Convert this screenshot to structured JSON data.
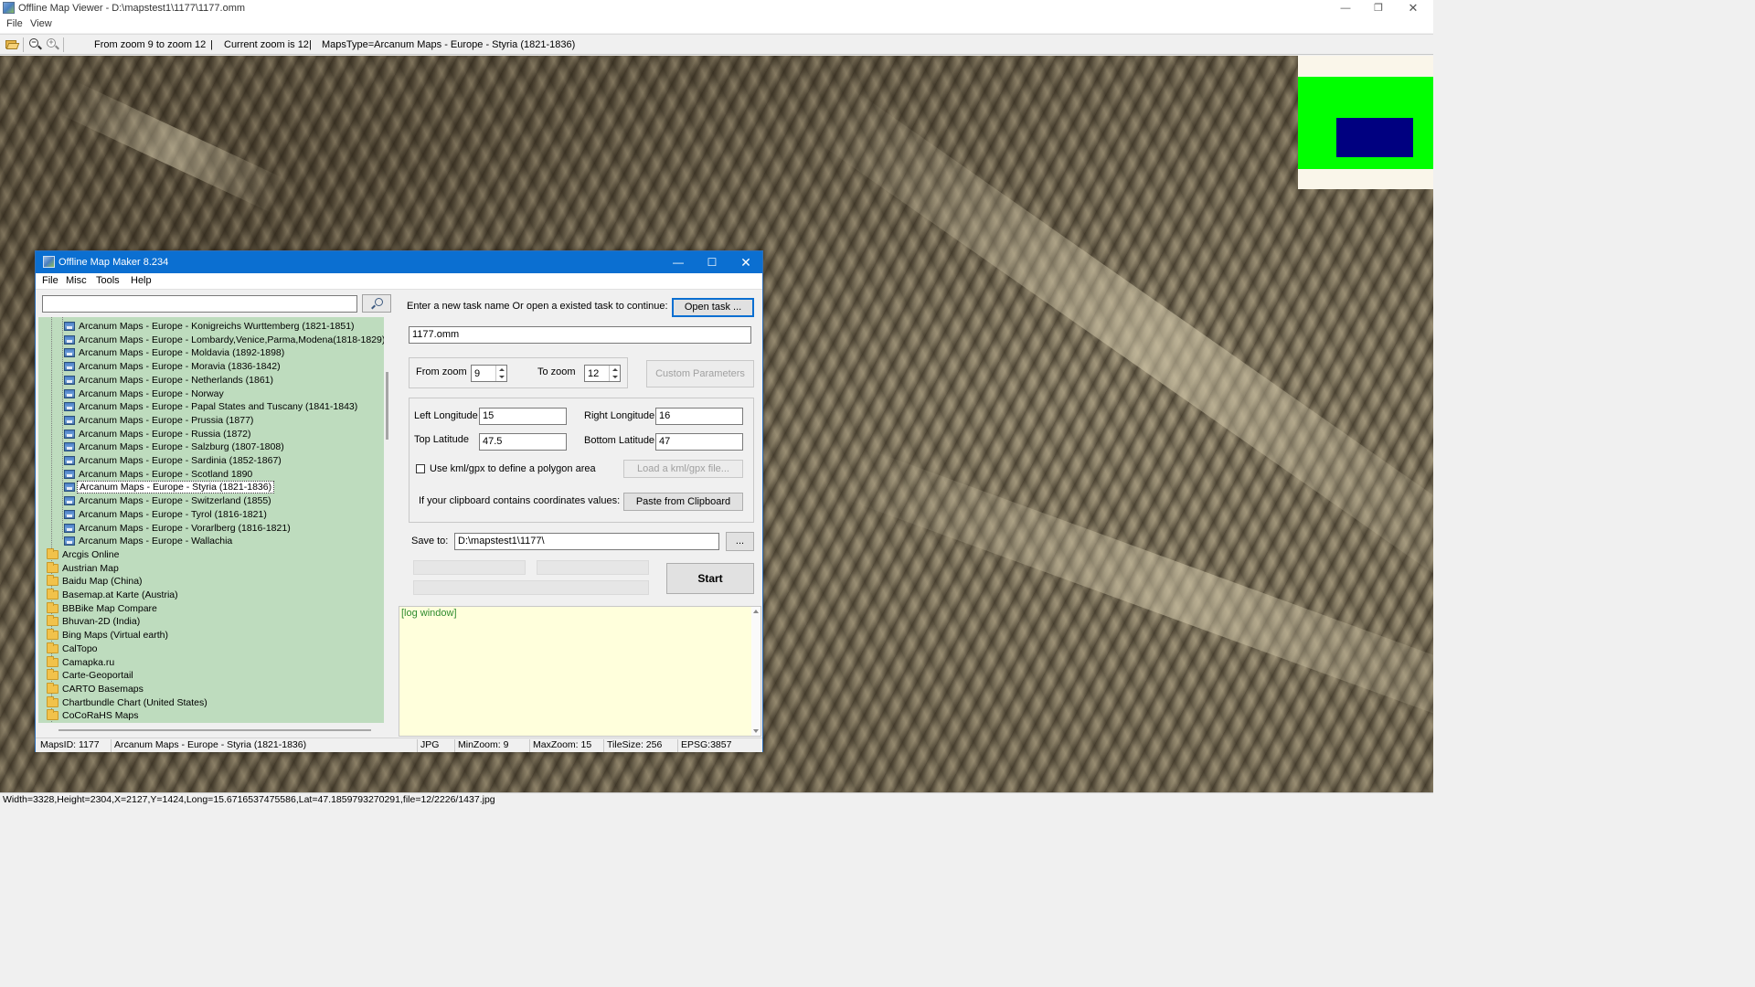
{
  "viewer": {
    "title": "Offline Map Viewer - D:\\mapstest1\\1177\\1177.omm",
    "menu": [
      "File",
      "View"
    ],
    "toolbar": {
      "zoom_range": "From zoom 9 to zoom 12",
      "sep1": "|",
      "current_zoom": "Current zoom is 12",
      "sep2": "|",
      "maps_type": "MapsType=Arcanum Maps - Europe - Styria (1821-1836)"
    },
    "status": "Width=3328,Height=2304,X=2127,Y=1424,Long=15.6716537475586,Lat=47.1859793270291,file=12/2226/1437.jpg",
    "window_controls": {
      "minimize": "—",
      "maximize": "❐",
      "close": "✕"
    }
  },
  "dialog": {
    "title": "Offline Map Maker 8.234",
    "menu": [
      "File",
      "Misc",
      "Tools",
      "Help"
    ],
    "window_controls": {
      "minimize": "—",
      "maximize": "☐",
      "close": "✕"
    },
    "search": {
      "value": ""
    },
    "tree": {
      "arcanum_items": [
        "Arcanum Maps - Europe - Konigreichs Wurttemberg (1821-1851)",
        "Arcanum Maps - Europe - Lombardy,Venice,Parma,Modena(1818-1829)",
        "Arcanum Maps - Europe - Moldavia (1892-1898)",
        "Arcanum Maps - Europe - Moravia (1836-1842)",
        "Arcanum Maps - Europe - Netherlands (1861)",
        "Arcanum Maps - Europe - Norway",
        "Arcanum Maps - Europe - Papal States and Tuscany (1841-1843)",
        "Arcanum Maps - Europe - Prussia (1877)",
        "Arcanum Maps - Europe - Russia (1872)",
        "Arcanum Maps - Europe - Salzburg (1807-1808)",
        "Arcanum Maps - Europe - Sardinia (1852-1867)",
        "Arcanum Maps - Europe - Scotland 1890",
        "Arcanum Maps - Europe - Styria (1821-1836)",
        "Arcanum Maps - Europe - Switzerland (1855)",
        "Arcanum Maps - Europe - Tyrol (1816-1821)",
        "Arcanum Maps - Europe - Vorarlberg (1816-1821)",
        "Arcanum Maps - Europe - Wallachia"
      ],
      "selected": "Arcanum Maps - Europe - Styria (1821-1836)",
      "folders": [
        "Arcgis Online",
        "Austrian Map",
        "Baidu Map (China)",
        "Basemap.at Karte (Austria)",
        "BBBike Map Compare",
        "Bhuvan-2D (India)",
        "Bing Maps (Virtual earth)",
        "CalTopo",
        "Camapka.ru",
        "Carte-Geoportail",
        "CARTO Basemaps",
        "Chartbundle Chart (United States)",
        "CoCoRaHS Maps"
      ]
    },
    "form": {
      "task_prompt": "Enter a new task name Or open a existed task to continue:",
      "open_task_label": "Open task ...",
      "task_name": "1177.omm",
      "from_zoom_label": "From zoom",
      "from_zoom": "9",
      "to_zoom_label": "To zoom",
      "to_zoom": "12",
      "custom_params_label": "Custom Parameters",
      "left_lon_label": "Left Longitude",
      "left_lon": "15",
      "right_lon_label": "Right Longitude",
      "right_lon": "16",
      "top_lat_label": "Top Latitude",
      "top_lat": "47.5",
      "bottom_lat_label": "Bottom Latitude",
      "bottom_lat": "47",
      "kml_checkbox_label": "Use kml/gpx to define a polygon area",
      "kml_checked": false,
      "load_kml_label": "Load a kml/gpx file...",
      "clipboard_prompt": "If your clipboard contains coordinates values:",
      "paste_clipboard_label": "Paste from Clipboard",
      "save_to_label": "Save to:",
      "save_to": "D:\\mapstest1\\1177\\",
      "browse_label": "...",
      "start_label": "Start",
      "log_text": "[log window]"
    },
    "status": {
      "maps_id": "MapsID: 1177",
      "map_name": "Arcanum Maps - Europe - Styria (1821-1836)",
      "format": "JPG",
      "min_zoom": "MinZoom: 9",
      "max_zoom": "MaxZoom: 15",
      "tile_size": "TileSize: 256",
      "epsg": "EPSG:3857"
    }
  },
  "colors": {
    "dialog_titlebar": "#0b6fd1",
    "tree_background": "#bedcbe",
    "log_background": "#ffffdc",
    "log_text": "#2e8b2e",
    "overview_background": "#00ff00",
    "overview_viewport": "#000080"
  }
}
